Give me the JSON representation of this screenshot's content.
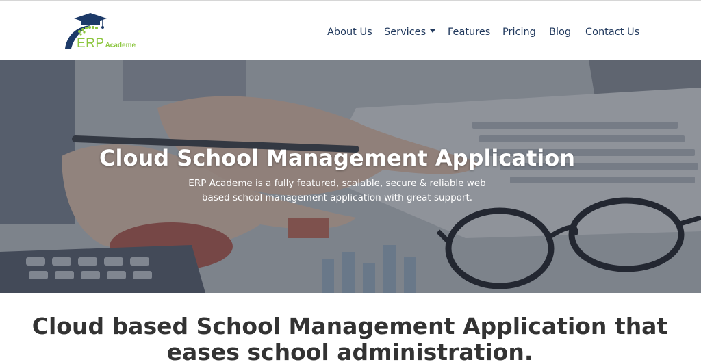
{
  "brand": {
    "name_main": "ERP",
    "name_sub": "Academe"
  },
  "nav": {
    "about": "About Us",
    "services": "Services",
    "features": "Features",
    "pricing": "Pricing",
    "blog": "Blog",
    "contact": "Contact Us"
  },
  "hero": {
    "title": "Cloud School Management Application",
    "subtitle_line1": "ERP Academe is a fully featured, scalable, secure & reliable web",
    "subtitle_line2": "based school management application with great support."
  },
  "section": {
    "heading_line1": "Cloud based School Management Application that",
    "heading_line2": "eases school administration."
  },
  "colors": {
    "nav_text": "#223a5e",
    "brand_green": "#8cc63f",
    "brand_navy": "#1d3a68",
    "heading_text": "#333333"
  }
}
